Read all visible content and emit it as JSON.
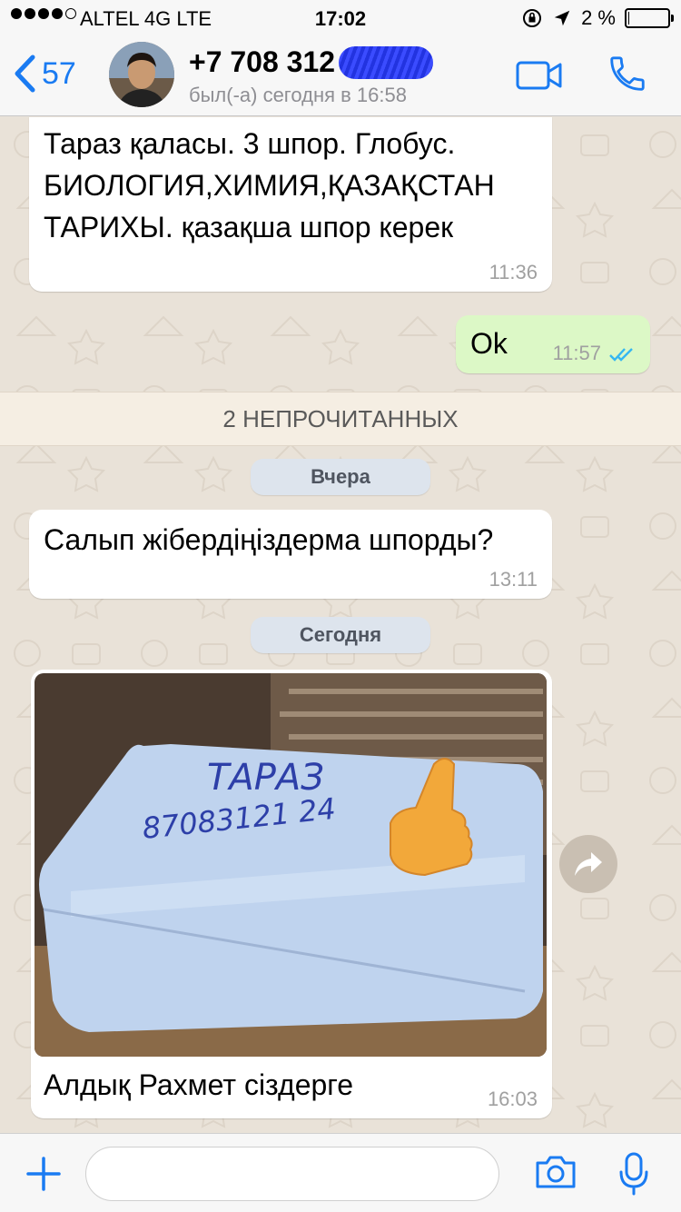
{
  "status_bar": {
    "carrier": "ALTEL 4G   LTE",
    "time": "17:02",
    "battery_text": "2 %",
    "battery_level": 0.02
  },
  "header": {
    "back_count": "57",
    "contact_name": "+7 708 312",
    "last_seen": "был(-а) сегодня в 16:58"
  },
  "messages": [
    {
      "text": "Тараз қаласы. 3 шпор. Глобус. БИОЛОГИЯ,ХИМИЯ,ҚАЗАҚСТАН ТАРИХЫ. қазақша шпор керек",
      "time": "11:36"
    },
    {
      "text": "Ok",
      "time": "11:57"
    },
    {
      "text": "Салып жібердіңіздерма шпорды?",
      "time": "13:11"
    },
    {
      "caption": "Алдық Рахмет сіздерге",
      "time": "16:03",
      "photo_text_1": "ТАРАЗ",
      "photo_text_2": "87083121 24"
    }
  ],
  "unread_banner": "2 НЕПРОЧИТАННЫХ",
  "date_separators": [
    "Вчера",
    "Сегодня"
  ],
  "input": {
    "placeholder": ""
  },
  "colors": {
    "accent": "#1a7bf2",
    "outgoing_bubble": "#dcf8c6",
    "read_ticks": "#34b7f1",
    "wallpaper": "#e9e2d8"
  },
  "icons": [
    "chevron-left-icon",
    "video-call-icon",
    "phone-icon",
    "plus-icon",
    "camera-icon",
    "microphone-icon",
    "double-check-icon",
    "forward-icon"
  ]
}
